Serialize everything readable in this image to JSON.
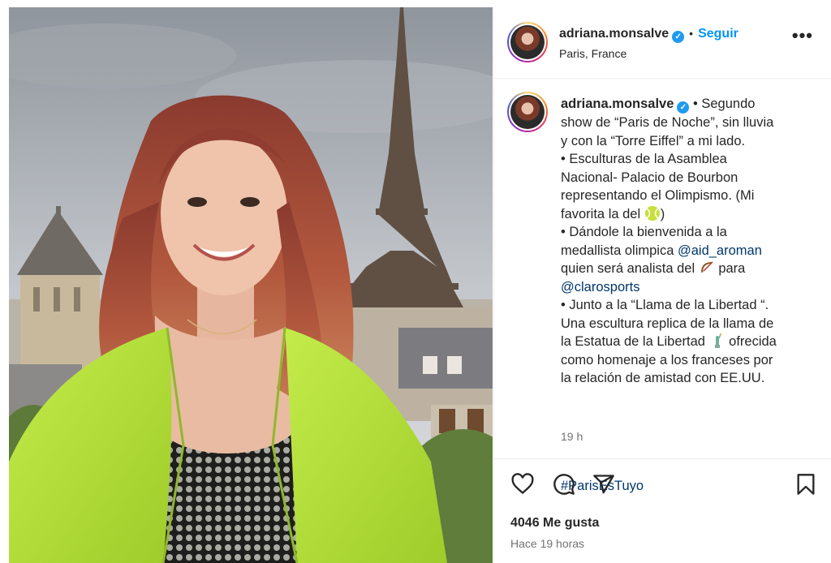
{
  "post": {
    "username": "adriana.monsalve",
    "follow_label": "Seguir",
    "separator": "•",
    "location": "Paris, France",
    "more_label": "•••",
    "caption": {
      "line1": "• Segundo",
      "line2": "show de “Paris de Noche”, sin lluvia",
      "line3": "y con la “Torre Eiffel” a mi lado.",
      "line4": "• Esculturas de la Asamblea",
      "line5": "Nacional- Palacio de Bourbon",
      "line6": "representando el Olimpismo. (Mi",
      "line7": "favorita la del",
      "line7_end": ")",
      "line8": "• Dándole la bienvenida a la",
      "line9": "medallista olimpica",
      "mention1": "@aid_aroman",
      "line10": "quien será analista del",
      "line10_end": "para",
      "mention2": "@clarosports",
      "line11": "• Junto a la “Llama de la Libertad “.",
      "line12": "Una escultura replica de la llama de",
      "line13": "la Estatua de la Libertad",
      "line13_end": "ofrecida",
      "line14": "como homenaje a los franceses por",
      "line15": "la relación de amistad con EE.UU.",
      "hashtag": "#ParisEsTuyo"
    },
    "time_ago": "19 h",
    "likes": "4046 Me gusta",
    "posted": "Hace 19 horas"
  },
  "icons": {
    "like": "heart-icon",
    "comment": "comment-icon",
    "share": "send-icon",
    "save": "bookmark-icon",
    "verified": "verified-badge-icon"
  },
  "colors": {
    "link": "#0095f6",
    "mention": "#00376b",
    "verified": "#1d9bf0",
    "jacket": "#b6e23a"
  }
}
